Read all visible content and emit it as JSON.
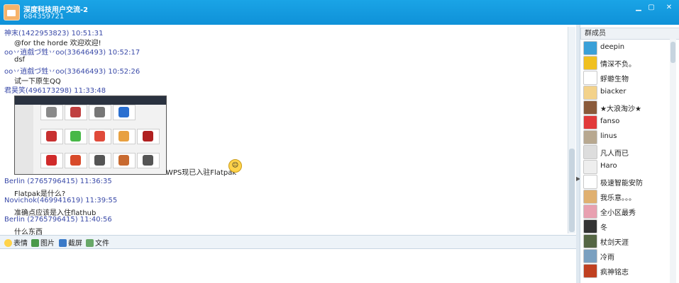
{
  "window": {
    "title": "深度科技用户交流-2",
    "group_id": "684359721",
    "controls": [
      "minimize-icon",
      "maximize-icon",
      "close-icon"
    ]
  },
  "messages": [
    {
      "sender": "神末(1422953823) 10:51:31",
      "text": "@for the horde  欢迎欢迎!"
    },
    {
      "sender": "oo丷逍戲づ甡丷oo(33646493) 10:52:17",
      "text": "dsf"
    },
    {
      "sender": "oo丷逍戲づ甡丷oo(33646493) 10:52:26",
      "text": "试一下原生QQ"
    },
    {
      "sender": "君昊笑(496173298) 11:33:48",
      "text": "WPS现已入驻Flatpak"
    },
    {
      "sender": "Berlin (2765796415) 11:36:35",
      "text": "Flatpak是什么?"
    },
    {
      "sender": "Novichok(469941619) 11:39:55",
      "text": "准确点应该是入住flathub"
    },
    {
      "sender": "Berlin (2765796415) 11:40:56",
      "text": "什么东西"
    }
  ],
  "toolbar": {
    "emoji": "表情",
    "image": "图片",
    "screenshot": "截屏",
    "file": "文件"
  },
  "members": {
    "header": "群成员",
    "list": [
      {
        "name": "deepin",
        "color": "#3aa0d8"
      },
      {
        "name": "情深不负。",
        "color": "#f0c020"
      },
      {
        "name": "蜉蝣生物",
        "color": "#ffffff"
      },
      {
        "name": "biacker",
        "color": "#f3d28a"
      },
      {
        "name": "★大浪淘沙★",
        "color": "#8a5a3a"
      },
      {
        "name": "fanso",
        "color": "#e23a3a"
      },
      {
        "name": "linus",
        "color": "#b8a890"
      },
      {
        "name": "凡人而已",
        "color": "#dddddd"
      },
      {
        "name": "Haro",
        "color": "#eeeeee"
      },
      {
        "name": "极速智能安防",
        "color": "#ffffff"
      },
      {
        "name": "我乐意。。。",
        "color": "#e0b070"
      },
      {
        "name": "全小区最秀",
        "color": "#e8a0b0"
      },
      {
        "name": "冬",
        "color": "#333333"
      },
      {
        "name": "杖剑天涯",
        "color": "#556644"
      },
      {
        "name": "冷雨",
        "color": "#7aa0c0"
      },
      {
        "name": "疯神铭志",
        "color": "#c04020"
      }
    ]
  }
}
